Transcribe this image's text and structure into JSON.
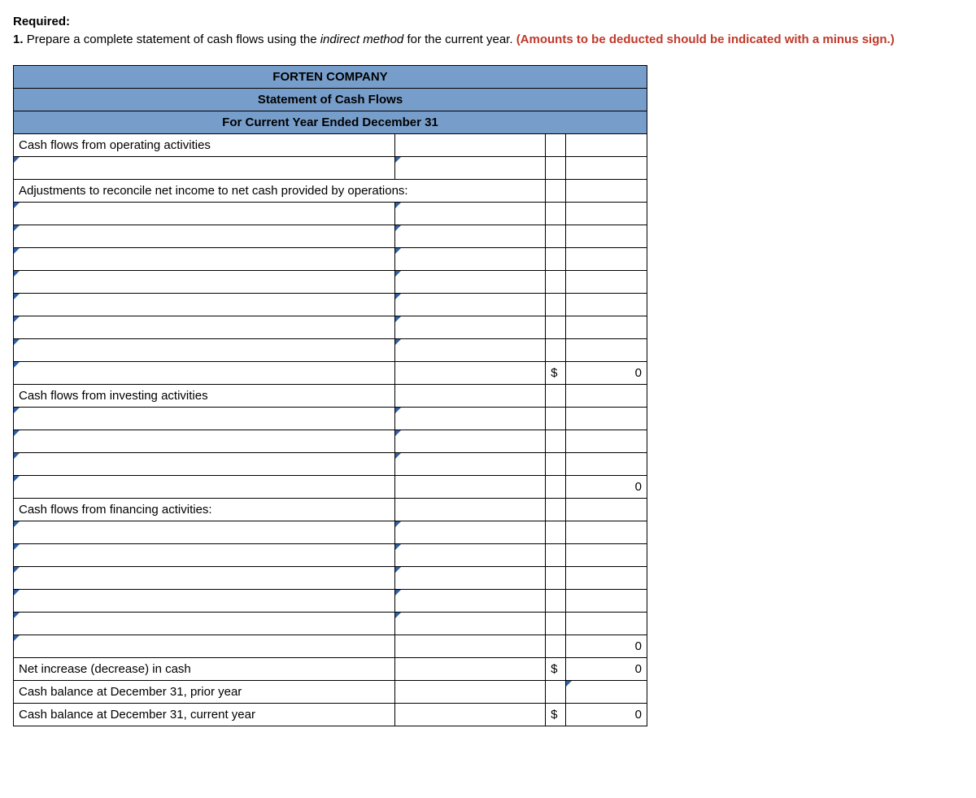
{
  "prompt": {
    "required_label": "Required:",
    "q_num": "1.",
    "text_a": "Prepare a complete statement of cash flows using the ",
    "italic": "indirect method",
    "text_b": " for the current year. ",
    "red": "(Amounts to be deducted should be indicated with a minus sign.)"
  },
  "header": {
    "company": "FORTEN COMPANY",
    "title": "Statement of Cash Flows",
    "period": "For Current Year Ended December 31"
  },
  "labels": {
    "cfo": "Cash flows from operating activities",
    "adjustments": "Adjustments to reconcile net income to net cash provided by operations:",
    "cfi": "Cash flows from investing activities",
    "cff": "Cash flows from financing activities:",
    "net_change": "Net increase (decrease) in cash",
    "prior_balance": "Cash balance at December 31, prior year",
    "current_balance": "Cash balance at December 31, current year"
  },
  "values": {
    "dollar": "$",
    "zero": "0"
  }
}
